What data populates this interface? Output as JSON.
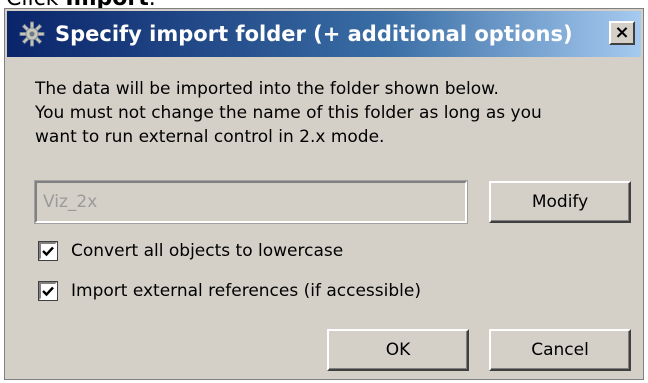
{
  "page_caption": {
    "prefix": "Click ",
    "bold": "Import",
    "suffix": "."
  },
  "dialog": {
    "title": "Specify import folder (+ additional options)",
    "close_label": "×",
    "message_lines": [
      "The data will be imported into the folder shown below.",
      "You must not change the name of this folder as long as you",
      "want to run external control in 2.x mode."
    ],
    "folder_value": "Viz_2x",
    "modify_label": "Modify",
    "options": [
      {
        "label": "Convert all objects to lowercase",
        "checked": true
      },
      {
        "label": "Import external references (if accessible)",
        "checked": true
      }
    ],
    "ok_label": "OK",
    "cancel_label": "Cancel"
  },
  "colors": {
    "titlebar_start": "#0a246a",
    "titlebar_end": "#a6caf0",
    "dialog_bg": "#d4d0c8"
  },
  "icons": {
    "title_icon": "gear-icon",
    "close_icon": "close-icon",
    "check_icon": "checkmark-icon"
  }
}
